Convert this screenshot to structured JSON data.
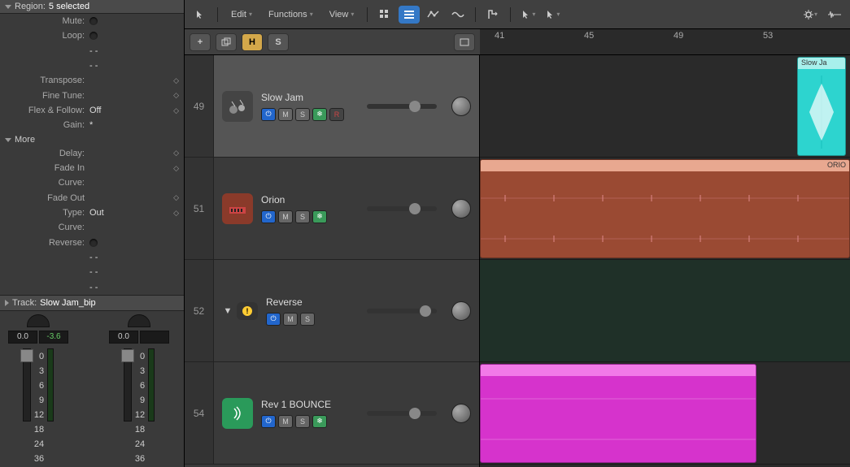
{
  "region": {
    "title": "Region:",
    "selected": "5 selected",
    "mute": "Mute:",
    "loop": "Loop:",
    "dash1": "- -",
    "dash2": "- -",
    "transpose": "Transpose:",
    "finetune": "Fine Tune:",
    "flexfollow": "Flex & Follow:",
    "flexval": "Off",
    "gain": "Gain:",
    "gainval": "*",
    "more": "More",
    "delay": "Delay:",
    "fadein": "Fade In",
    "curve1": "Curve:",
    "fadeout": "Fade Out",
    "type": "Type:",
    "typeval": "Out",
    "curve2": "Curve:",
    "reverse": "Reverse:",
    "dash3": "- -",
    "dash4": "- -",
    "dash5": "- -"
  },
  "track_section": {
    "label": "Track:",
    "name": "Slow Jam_bip"
  },
  "mixer": {
    "ch1_val1": "0.0",
    "ch1_val2": "-3.6",
    "ch2_val1": "0.0",
    "scale": [
      "0",
      "3",
      "6",
      "9",
      "12",
      "18",
      "24",
      "36"
    ]
  },
  "toolbar": {
    "edit": "Edit",
    "functions": "Functions",
    "view": "View"
  },
  "subbar": {
    "h": "H",
    "s": "S"
  },
  "ruler": [
    "41",
    "45",
    "49",
    "53"
  ],
  "tracks": [
    {
      "num": "49",
      "name": "Slow Jam",
      "icon": "drums",
      "rec": true,
      "frz": true
    },
    {
      "num": "51",
      "name": "Orion",
      "icon": "synth",
      "frz": true
    },
    {
      "num": "52",
      "name": "Reverse",
      "icon": "warn",
      "expand": true
    },
    {
      "num": "54",
      "name": "Rev 1 BOUNCE",
      "icon": "audio",
      "frz": true
    }
  ],
  "regions": {
    "slowja": "Slow Ja",
    "orio": "ORIO"
  }
}
